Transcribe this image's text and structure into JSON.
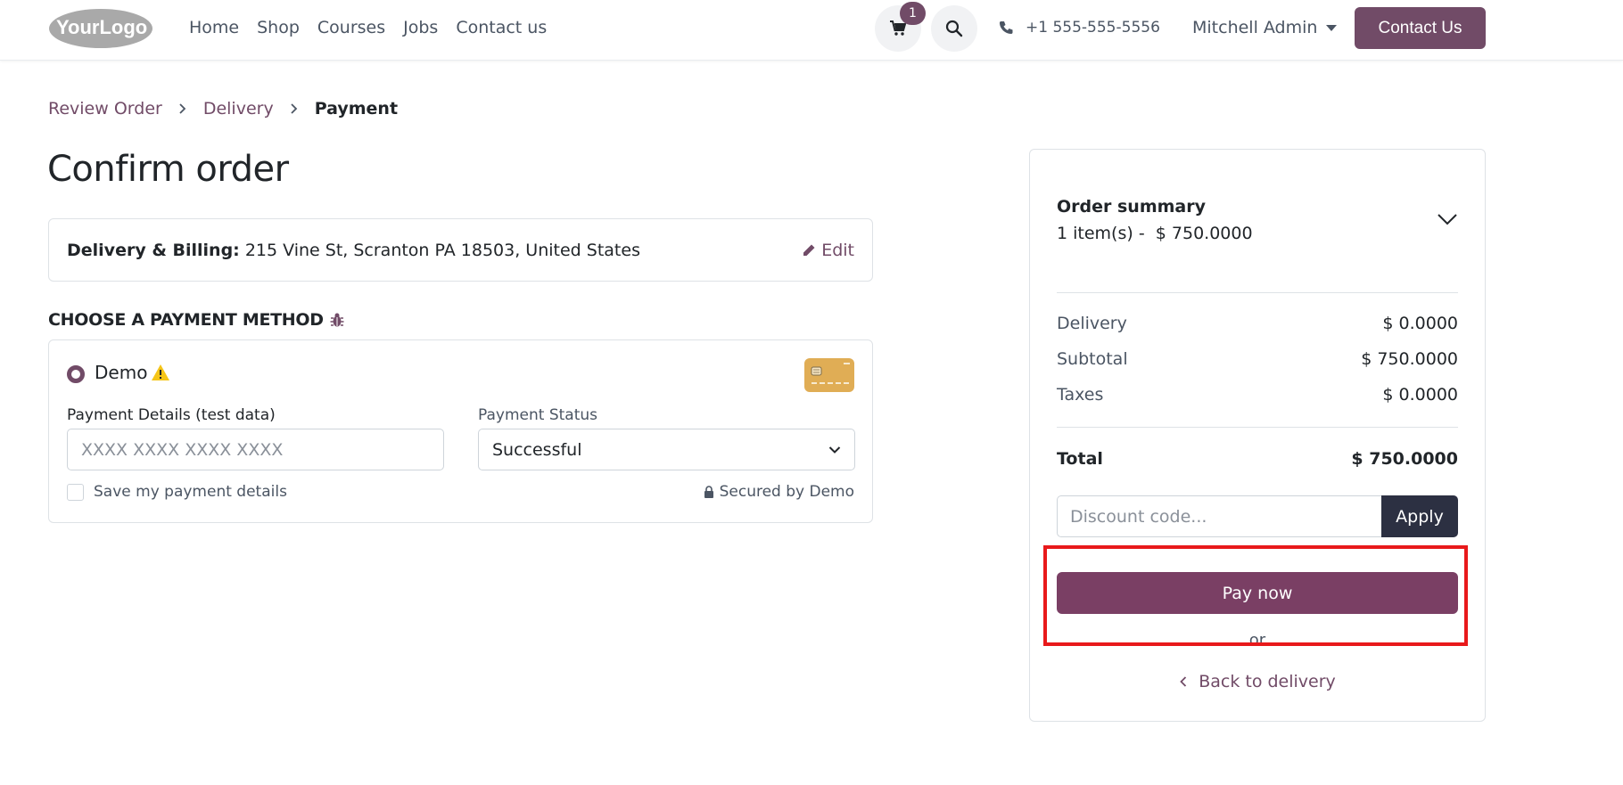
{
  "header": {
    "logo_text": "YourLogo",
    "nav": [
      "Home",
      "Shop",
      "Courses",
      "Jobs",
      "Contact us"
    ],
    "cart_count": "1",
    "phone": "+1 555-555-5556",
    "user": "Mitchell Admin",
    "contact_button": "Contact Us",
    "brand_color": "#714b67"
  },
  "breadcrumb": {
    "items": [
      "Review Order",
      "Delivery",
      "Payment"
    ]
  },
  "page_title": "Confirm order",
  "address": {
    "label": "Delivery & Billing:",
    "value": "215 Vine St, Scranton PA 18503, United States",
    "edit_label": "Edit"
  },
  "payment": {
    "heading": "CHOOSE A PAYMENT METHOD",
    "method_name": "Demo",
    "details_label": "Payment Details (test data)",
    "details_placeholder": "XXXX XXXX XXXX XXXX",
    "status_label": "Payment Status",
    "status_value": "Successful",
    "save_label": "Save my payment details",
    "secured_label": "Secured by Demo"
  },
  "summary": {
    "title": "Order summary",
    "items_count": "1 item(s) -",
    "items_total": "$ 750.0000",
    "delivery_label": "Delivery",
    "delivery_value": "$ 0.0000",
    "subtotal_label": "Subtotal",
    "subtotal_value": "$ 750.0000",
    "taxes_label": "Taxes",
    "taxes_value": "$ 0.0000",
    "total_label": "Total",
    "total_value": "$ 750.0000",
    "discount_placeholder": "Discount code...",
    "apply_label": "Apply",
    "pay_now_label": "Pay now",
    "or_label": "or",
    "back_label": "Back to delivery"
  },
  "highlight_color": "#e8191b"
}
